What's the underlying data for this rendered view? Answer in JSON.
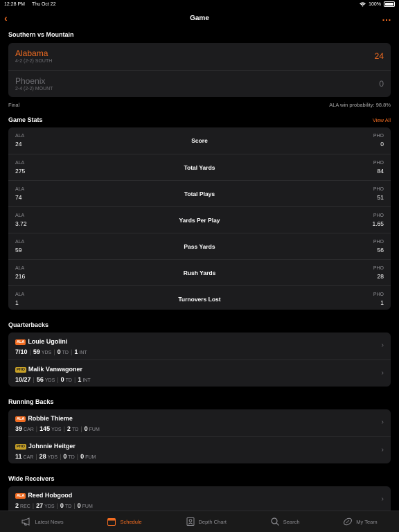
{
  "status": {
    "time": "12:28 PM",
    "date": "Thu Oct 22",
    "battery": "100%"
  },
  "nav": {
    "title": "Game",
    "back_icon": "chevron-left-icon",
    "more_icon": "ellipsis-icon"
  },
  "matchup": {
    "title": "Southern vs Mountain",
    "home": {
      "name": "Alabama",
      "record": "4-2 (2-2) SOUTH",
      "score": "24"
    },
    "away": {
      "name": "Phoenix",
      "record": "2-4 (2-2) MOUNT",
      "score": "0"
    },
    "status": "Final",
    "win_prob": "ALA win probability: 98.8%"
  },
  "game_stats": {
    "title": "Game Stats",
    "view_all": "View All",
    "left_abbr": "ALA",
    "right_abbr": "PHO",
    "rows": [
      {
        "label": "Score",
        "left": "24",
        "right": "0"
      },
      {
        "label": "Total Yards",
        "left": "275",
        "right": "84"
      },
      {
        "label": "Total Plays",
        "left": "74",
        "right": "51"
      },
      {
        "label": "Yards Per Play",
        "left": "3.72",
        "right": "1.65"
      },
      {
        "label": "Pass Yards",
        "left": "59",
        "right": "56"
      },
      {
        "label": "Rush Yards",
        "left": "216",
        "right": "28"
      },
      {
        "label": "Turnovers Lost",
        "left": "1",
        "right": "1"
      }
    ]
  },
  "quarterbacks": {
    "title": "Quarterbacks",
    "players": [
      {
        "team": "ALA",
        "name": "Louie Ugolini",
        "stats": [
          [
            "7/10",
            ""
          ],
          [
            "59",
            "YDS"
          ],
          [
            "0",
            "TD"
          ],
          [
            "1",
            "INT"
          ]
        ]
      },
      {
        "team": "PHO",
        "name": "Malik Vanwagoner",
        "stats": [
          [
            "10/27",
            ""
          ],
          [
            "56",
            "YDS"
          ],
          [
            "0",
            "TD"
          ],
          [
            "1",
            "INT"
          ]
        ]
      }
    ]
  },
  "running_backs": {
    "title": "Running Backs",
    "players": [
      {
        "team": "ALA",
        "name": "Robbie Thieme",
        "stats": [
          [
            "39",
            "CAR"
          ],
          [
            "145",
            "YDS"
          ],
          [
            "2",
            "TD"
          ],
          [
            "0",
            "FUM"
          ]
        ]
      },
      {
        "team": "PHO",
        "name": "Johnnie Heitger",
        "stats": [
          [
            "11",
            "CAR"
          ],
          [
            "28",
            "YDS"
          ],
          [
            "0",
            "TD"
          ],
          [
            "0",
            "FUM"
          ]
        ]
      }
    ]
  },
  "wide_receivers": {
    "title": "Wide Receivers",
    "players": [
      {
        "team": "ALA",
        "name": "Reed Hobgood",
        "stats": [
          [
            "2",
            "REC"
          ],
          [
            "27",
            "YDS"
          ],
          [
            "0",
            "TD"
          ],
          [
            "0",
            "FUM"
          ]
        ]
      }
    ]
  },
  "tabs": [
    {
      "label": "Latest News",
      "icon": "megaphone-icon",
      "active": false
    },
    {
      "label": "Schedule",
      "icon": "calendar-icon",
      "active": true
    },
    {
      "label": "Depth Chart",
      "icon": "roster-icon",
      "active": false
    },
    {
      "label": "Search",
      "icon": "search-icon",
      "active": false
    },
    {
      "label": "My Team",
      "icon": "football-icon",
      "active": false
    }
  ],
  "colors": {
    "accent": "#f26c21",
    "card": "#1c1c1e",
    "pho_badge": "#c9a227"
  }
}
